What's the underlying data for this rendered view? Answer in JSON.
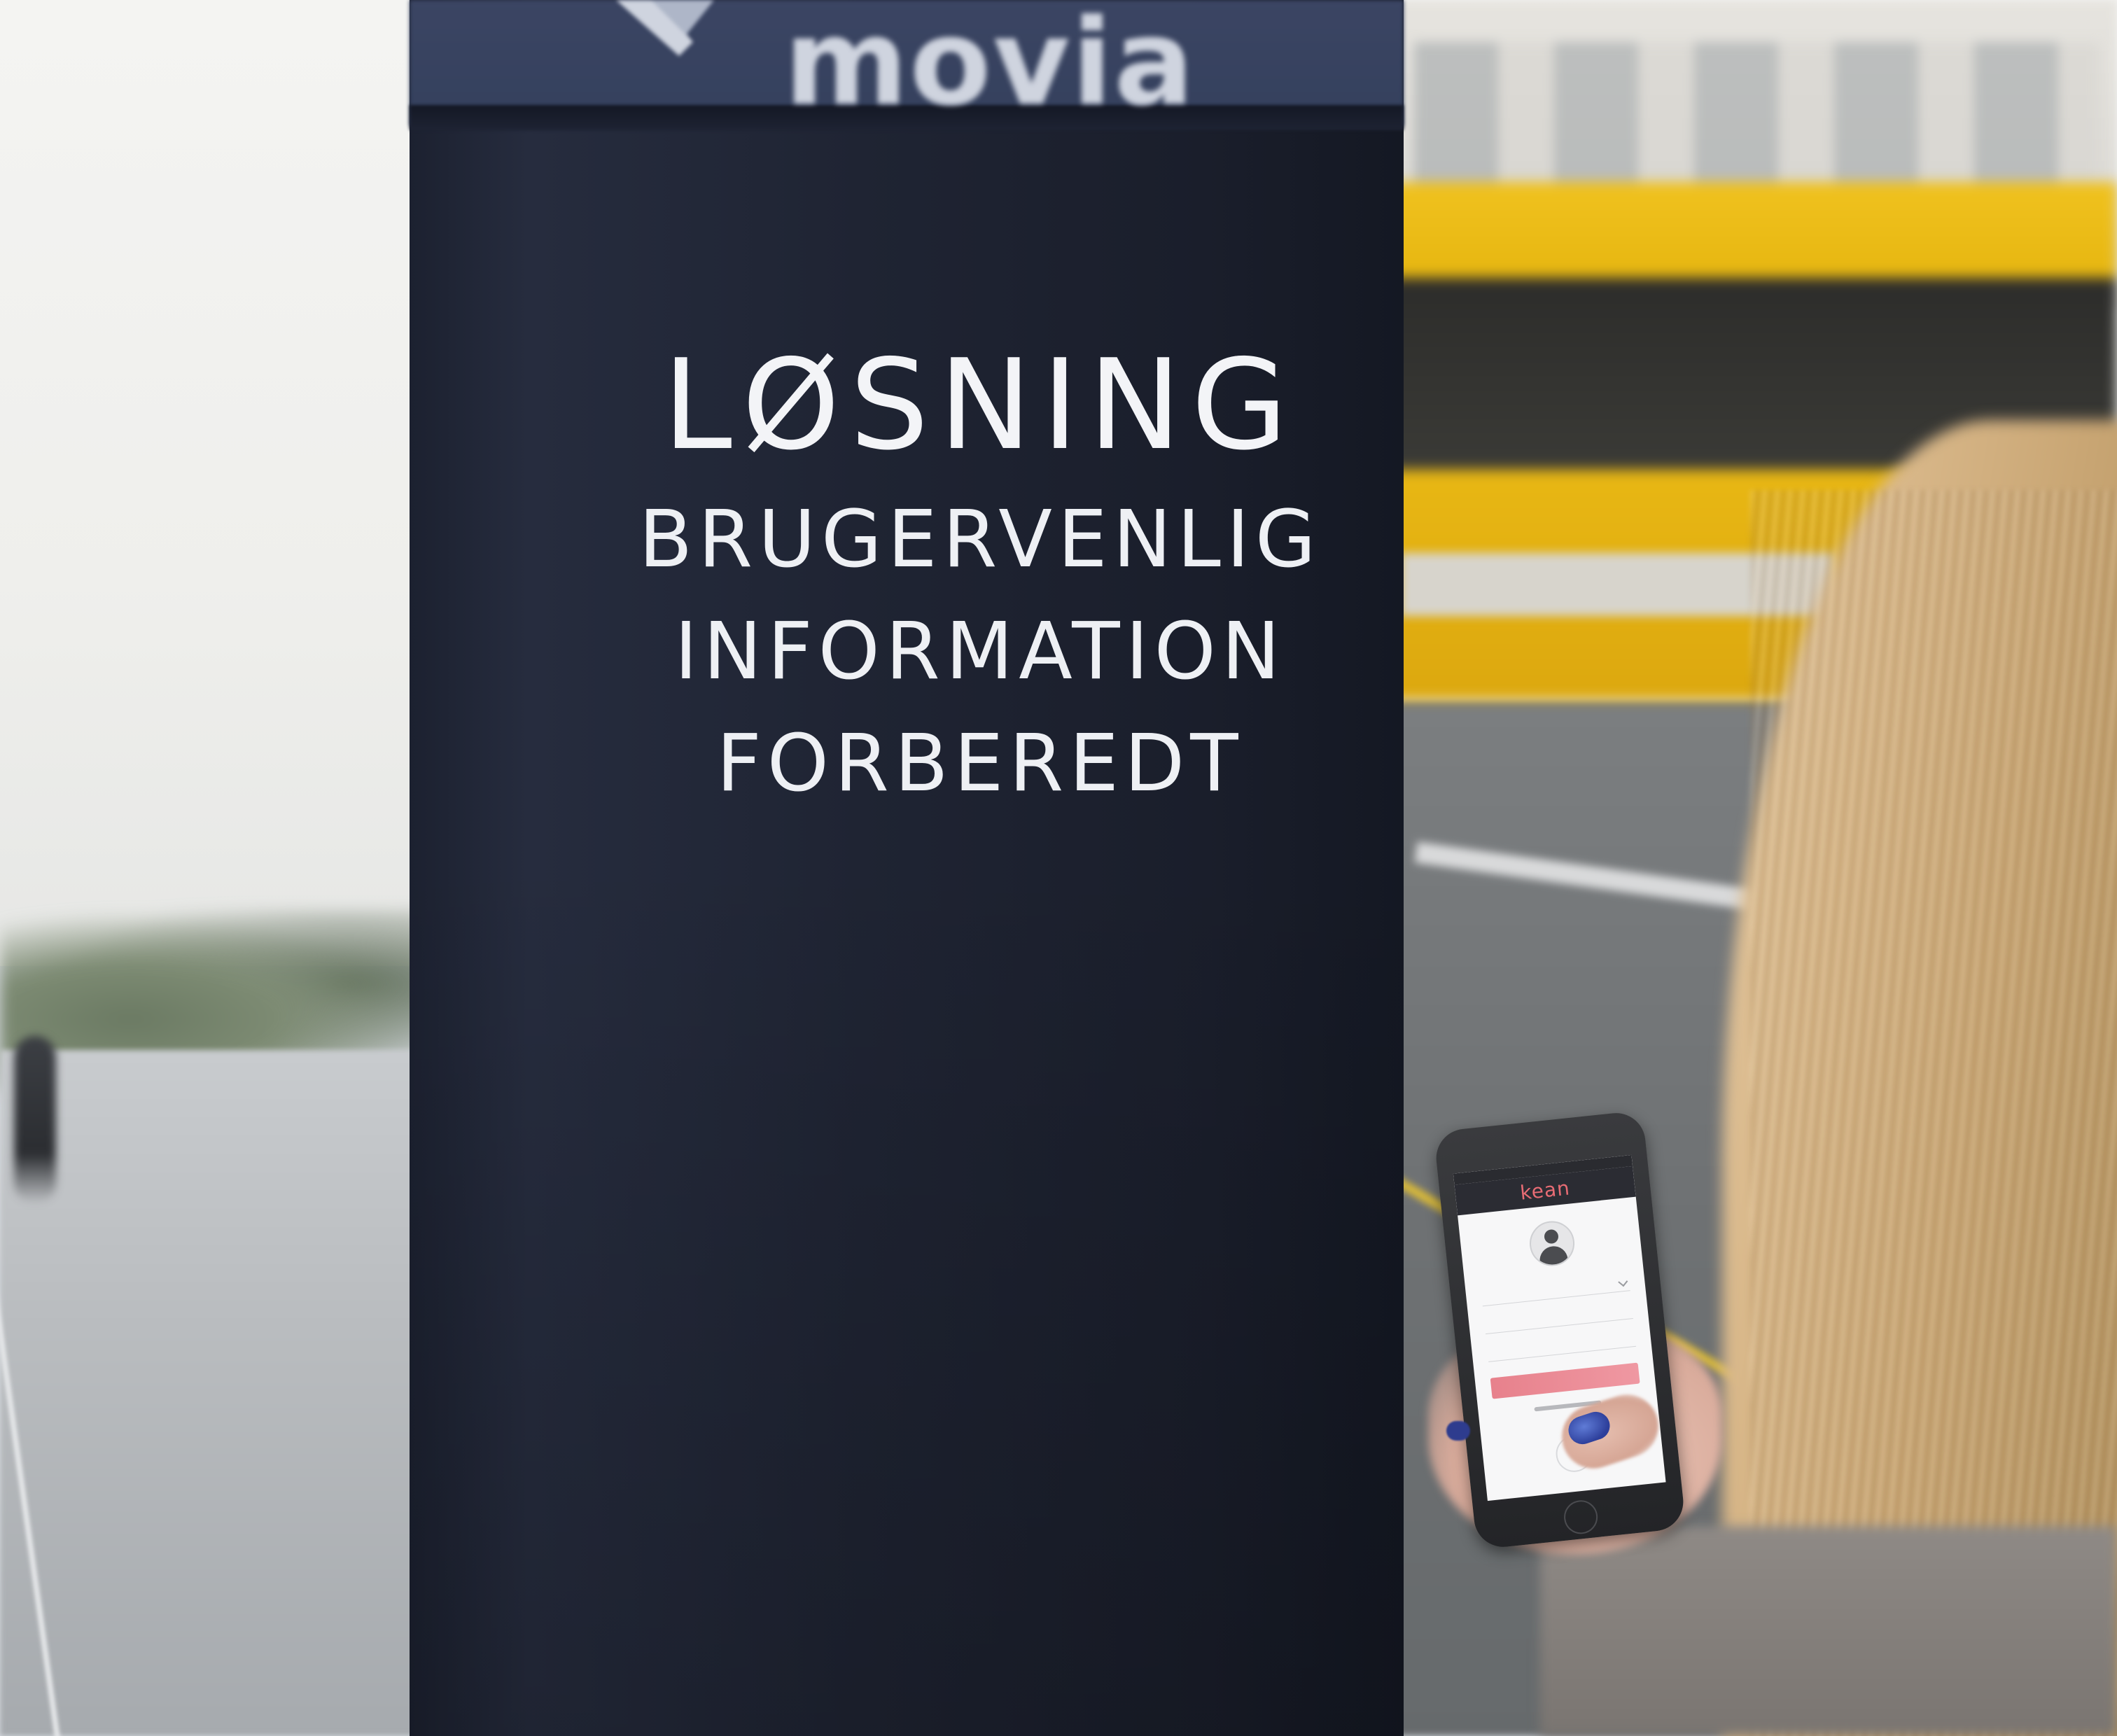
{
  "sign": {
    "brand": "movia",
    "title": "LØSNING",
    "lines": [
      "BRUGERVENLIG",
      "INFORMATION",
      "FORBEREDT"
    ]
  },
  "phone": {
    "app_name": "kean",
    "accent_color": "#e86c74"
  },
  "colors": {
    "pillar": "#1f2433",
    "bus": "#e7b711",
    "nail_polish": "#2d3f9b"
  }
}
